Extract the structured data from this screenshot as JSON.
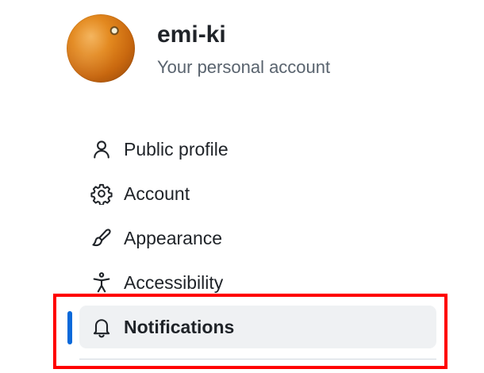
{
  "header": {
    "username": "emi-ki",
    "subtitle": "Your personal account"
  },
  "nav": {
    "items": [
      {
        "label": "Public profile",
        "icon": "person-icon",
        "selected": false
      },
      {
        "label": "Account",
        "icon": "gear-icon",
        "selected": false
      },
      {
        "label": "Appearance",
        "icon": "paintbrush-icon",
        "selected": false
      },
      {
        "label": "Accessibility",
        "icon": "accessibility-icon",
        "selected": false
      },
      {
        "label": "Notifications",
        "icon": "bell-icon",
        "selected": true
      }
    ]
  },
  "colors": {
    "accent": "#0969da",
    "selected_bg": "#eff1f3",
    "annotation": "#ff0000",
    "text": "#1f2328",
    "muted": "#59636e"
  }
}
